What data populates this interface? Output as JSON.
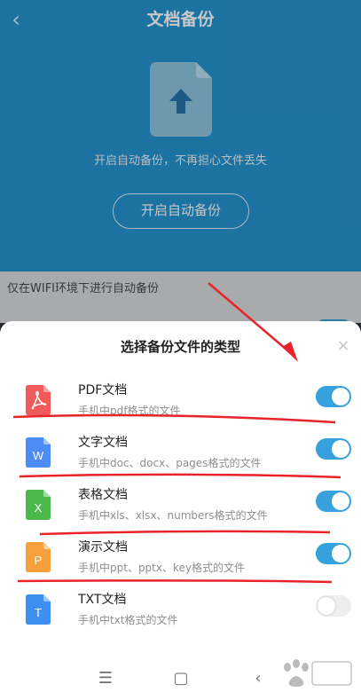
{
  "header": {
    "back_glyph": "‹",
    "title": "文档备份",
    "subtitle": "开启自动备份，不再担心文件丢失",
    "enable_button": "开启自动备份",
    "accent": "#2592cf"
  },
  "wifi_note": "仅在WIFI环境下进行自动备份",
  "sheet": {
    "title": "选择备份文件的类型",
    "close_glyph": "×",
    "items": [
      {
        "name": "PDF文档",
        "desc": "手机中pdf格式的文件",
        "icon": "pdf-icon",
        "icon_color": "#f05a5a",
        "enabled": true
      },
      {
        "name": "文字文档",
        "desc": "手机中doc、docx、pages格式的文件",
        "icon": "word-icon",
        "icon_letter": "W",
        "icon_color": "#4d8ef6",
        "enabled": true
      },
      {
        "name": "表格文档",
        "desc": "手机中xls、xlsx、numbers格式的文件",
        "icon": "excel-icon",
        "icon_letter": "X",
        "icon_color": "#4cb84c",
        "enabled": true
      },
      {
        "name": "演示文档",
        "desc": "手机中ppt、pptx、key格式的文件",
        "icon": "ppt-icon",
        "icon_letter": "P",
        "icon_color": "#f5a03c",
        "enabled": true
      },
      {
        "name": "TXT文档",
        "desc": "手机中txt格式的文件",
        "icon": "txt-icon",
        "icon_letter": "T",
        "icon_color": "#3d8ff0",
        "enabled": false
      }
    ]
  },
  "navbar": {
    "menu_glyph": "☰",
    "home_glyph": "▢",
    "back_glyph": "‹"
  },
  "colors": {
    "toggle_on": "#36a1dd",
    "annotation_red": "#e8242a"
  }
}
